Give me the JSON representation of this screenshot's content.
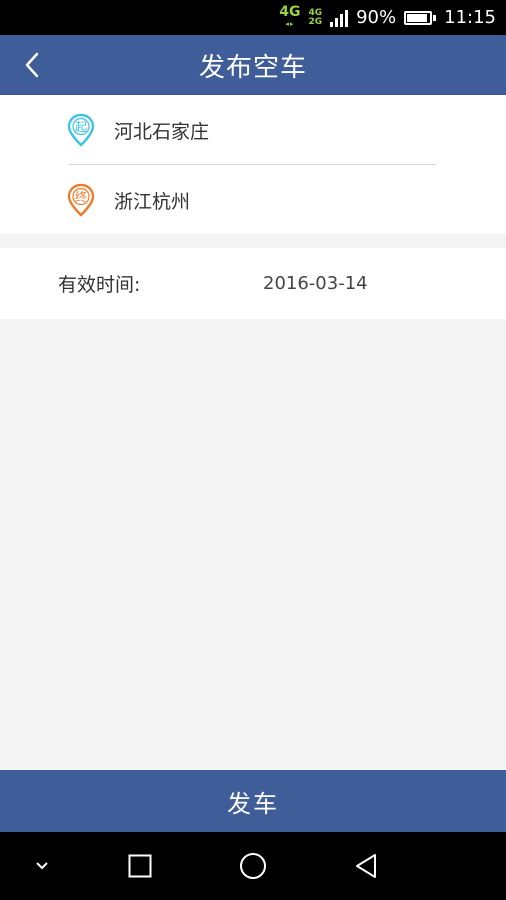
{
  "status_bar": {
    "network_primary": "4G",
    "network_secondary_top": "4G",
    "network_secondary_bottom": "2G",
    "battery_percent": "90%",
    "battery_level": 0.9,
    "time": "11:15"
  },
  "header": {
    "title": "发布空车",
    "back_icon": "chevron-left-icon"
  },
  "route": {
    "start_icon_label": "起",
    "start_location": "河北石家庄",
    "end_icon_label": "终",
    "end_location": "浙江杭州"
  },
  "validity": {
    "label": "有效时间:",
    "value": "2016-03-14"
  },
  "submit": {
    "label": "发车"
  },
  "colors": {
    "brand_blue": "#3f5d99",
    "start_pin": "#3ec3e8",
    "end_pin": "#f07c2a",
    "background": "#f4f4f4"
  }
}
